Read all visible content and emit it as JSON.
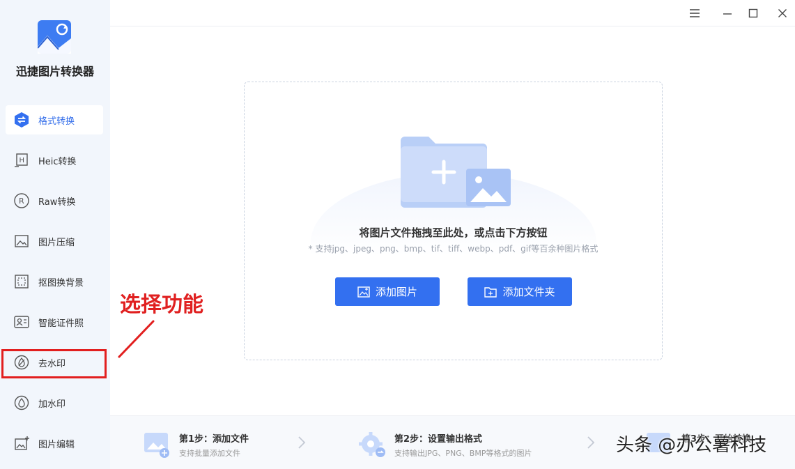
{
  "app": {
    "name": "迅捷图片转换器"
  },
  "sidebar": {
    "items": [
      {
        "label": "格式转换",
        "icon": "convert-icon",
        "active": true
      },
      {
        "label": "Heic转换",
        "icon": "heic-icon"
      },
      {
        "label": "Raw转换",
        "icon": "raw-icon"
      },
      {
        "label": "图片压缩",
        "icon": "compress-icon"
      },
      {
        "label": "抠图换背景",
        "icon": "cutout-icon"
      },
      {
        "label": "智能证件照",
        "icon": "id-photo-icon"
      },
      {
        "label": "去水印",
        "icon": "remove-watermark-icon"
      },
      {
        "label": "加水印",
        "icon": "add-watermark-icon"
      },
      {
        "label": "图片编辑",
        "icon": "image-edit-icon"
      }
    ]
  },
  "dropzone": {
    "title": "将图片文件拖拽至此处，或点击下方按钮",
    "subtitle": "* 支持jpg、jpeg、png、bmp、tif、tiff、webp、pdf、gif等百余种图片格式",
    "add_image_label": "添加图片",
    "add_folder_label": "添加文件夹"
  },
  "annotation": {
    "text": "选择功能"
  },
  "steps": [
    {
      "title": "第1步：添加文件",
      "desc": "支持批量添加文件"
    },
    {
      "title": "第2步：设置输出格式",
      "desc": "支持输出JPG、PNG、BMP等格式的图片"
    },
    {
      "title": "第3步：开始转换",
      "desc": ""
    }
  ],
  "watermark": {
    "text": "头条 @办公薯科技"
  },
  "colors": {
    "accent": "#3370f0",
    "annotation": "#e21f1f",
    "sidebar_bg": "#f2f6fc"
  }
}
